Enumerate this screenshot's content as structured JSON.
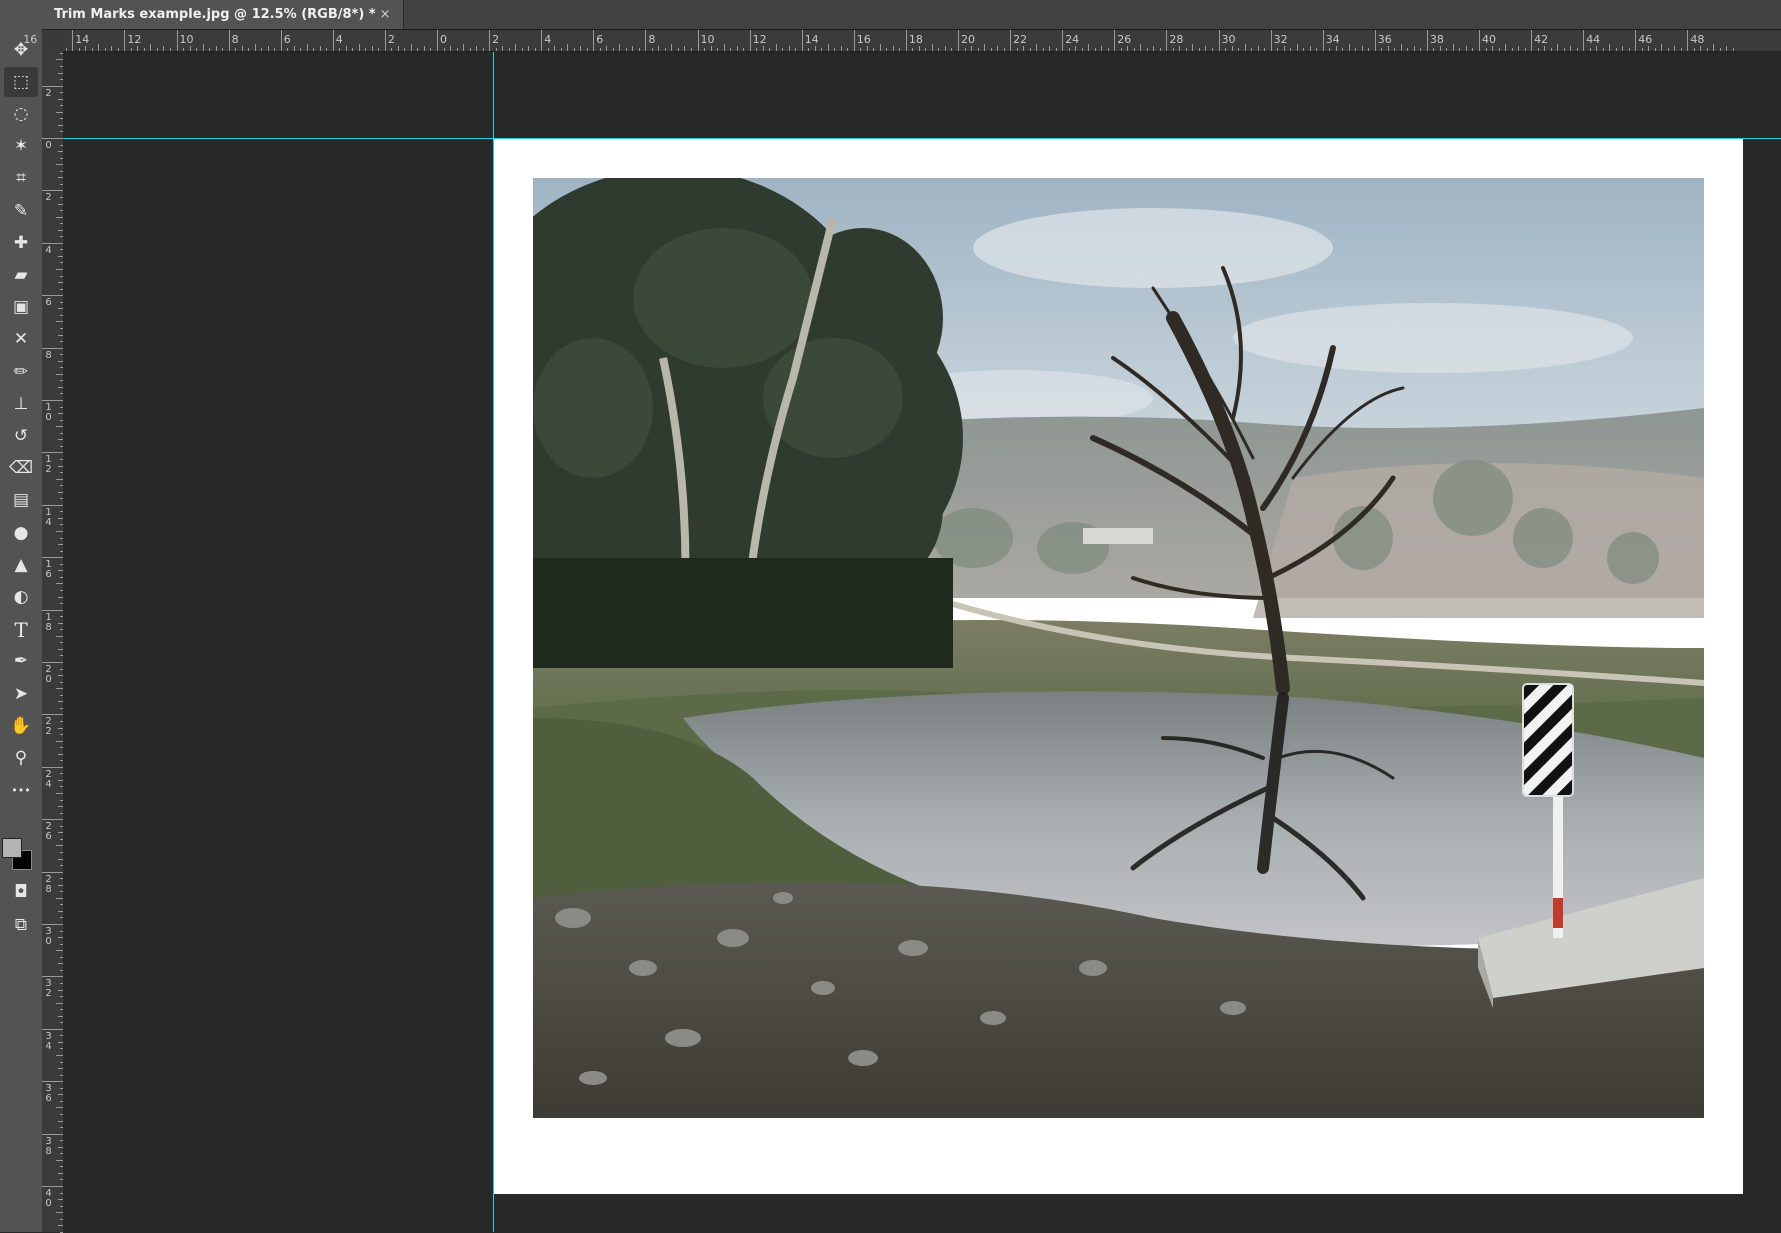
{
  "document_tab": {
    "title": "Trim Marks example.jpg @ 12.5% (RGB/8*) *",
    "close_glyph": "×"
  },
  "tools": [
    {
      "name": "move-tool",
      "icon": "move-icon",
      "glyph": "✥"
    },
    {
      "name": "rectangular-marquee-tool",
      "icon": "marquee-icon",
      "glyph": "⬚",
      "selected": true
    },
    {
      "name": "lasso-tool",
      "icon": "lasso-icon",
      "glyph": "◌"
    },
    {
      "name": "magic-wand-tool",
      "icon": "magic-wand-icon",
      "glyph": "✶"
    },
    {
      "name": "crop-tool",
      "icon": "crop-icon",
      "glyph": "⌗"
    },
    {
      "name": "eyedropper-tool",
      "icon": "eyedropper-icon",
      "glyph": "✎"
    },
    {
      "name": "spot-healing-brush-tool",
      "icon": "spot-healing-icon",
      "glyph": "✚"
    },
    {
      "name": "healing-brush-tool",
      "icon": "bandage-icon",
      "glyph": "▰"
    },
    {
      "name": "patch-tool",
      "icon": "patch-icon",
      "glyph": "▣"
    },
    {
      "name": "content-aware-move-tool",
      "icon": "content-aware-move-icon",
      "glyph": "✕"
    },
    {
      "name": "brush-tool",
      "icon": "brush-icon",
      "glyph": "✏"
    },
    {
      "name": "clone-stamp-tool",
      "icon": "stamp-icon",
      "glyph": "⊥"
    },
    {
      "name": "history-brush-tool",
      "icon": "history-brush-icon",
      "glyph": "↺"
    },
    {
      "name": "eraser-tool",
      "icon": "eraser-icon",
      "glyph": "⌫"
    },
    {
      "name": "gradient-tool",
      "icon": "gradient-icon",
      "glyph": "▤"
    },
    {
      "name": "blur-tool",
      "icon": "blur-drop-icon",
      "glyph": "●"
    },
    {
      "name": "sharpen-tool",
      "icon": "sharpen-icon",
      "glyph": "▲"
    },
    {
      "name": "dodge-tool",
      "icon": "dodge-icon",
      "glyph": "◐"
    },
    {
      "name": "type-tool",
      "icon": "type-icon",
      "glyph": "T"
    },
    {
      "name": "pen-tool",
      "icon": "pen-icon",
      "glyph": "✒"
    },
    {
      "name": "path-selection-tool",
      "icon": "arrow-icon",
      "glyph": "➤"
    },
    {
      "name": "hand-tool",
      "icon": "hand-icon",
      "glyph": "✋"
    },
    {
      "name": "zoom-tool",
      "icon": "zoom-icon",
      "glyph": "⚲"
    },
    {
      "name": "edit-toolbar",
      "icon": "more-icon",
      "glyph": "•••"
    }
  ],
  "extra_tools": [
    {
      "name": "quick-mask-mode",
      "icon": "quick-mask-icon",
      "glyph": "◘"
    },
    {
      "name": "screen-mode",
      "icon": "screen-mode-icon",
      "glyph": "⧉"
    }
  ],
  "colors": {
    "foreground": "#b4b4b4",
    "background": "#000000",
    "guide": "#24d1e3",
    "canvas": "#282828"
  },
  "horizontal_ruler": {
    "labels": [
      "16",
      "14",
      "12",
      "10",
      "8",
      "6",
      "4",
      "2",
      "0",
      "2",
      "4",
      "6",
      "8",
      "10",
      "12",
      "14",
      "16",
      "18",
      "20",
      "22",
      "24",
      "26",
      "28",
      "30",
      "32",
      "34",
      "36",
      "38",
      "40",
      "42",
      "44",
      "46",
      "48"
    ]
  },
  "vertical_ruler": {
    "labels": [
      "2",
      "0",
      "2",
      "4",
      "6",
      "8",
      "10",
      "12",
      "14",
      "16",
      "18",
      "20",
      "22",
      "24",
      "26",
      "28",
      "30",
      "32",
      "34",
      "36",
      "38",
      "40"
    ]
  }
}
